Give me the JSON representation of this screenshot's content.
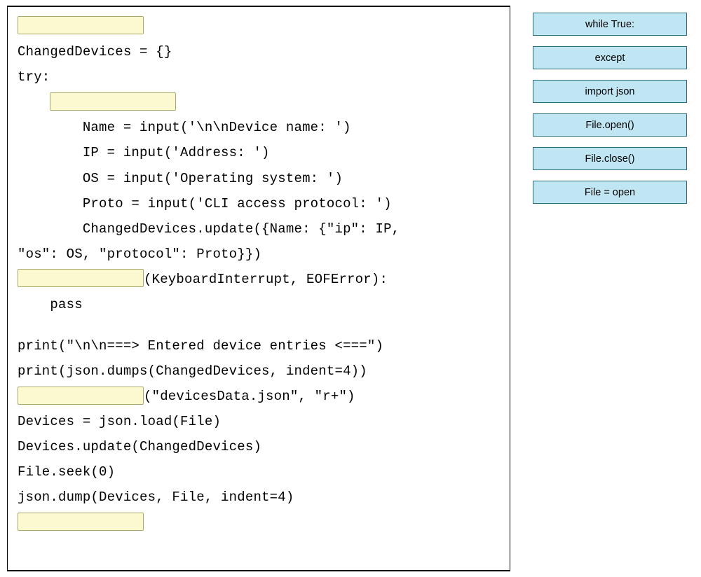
{
  "code": {
    "l1": "ChangedDevices = {}",
    "l2": "try:",
    "l3": "        Name = input('\\n\\nDevice name: ')",
    "l4": "        IP = input('Address: ')",
    "l5": "        OS = input('Operating system: ')",
    "l6": "        Proto = input('CLI access protocol: ')",
    "l7": "        ChangedDevices.update({Name: {\"ip\": IP,",
    "l8": "\"os\": OS, \"protocol\": Proto}})",
    "l9": "(KeyboardInterrupt, EOFError):",
    "l10": "    pass",
    "l11": "print(\"\\n\\n===> Entered device entries <===\")",
    "l12": "print(json.dumps(ChangedDevices, indent=4))",
    "l13": "(\"devicesData.json\", \"r+\")",
    "l14": "Devices = json.load(File)",
    "l15": "Devices.update(ChangedDevices)",
    "l16": "File.seek(0)",
    "l17": "json.dump(Devices, File, indent=4)"
  },
  "choices": {
    "c1": "while True:",
    "c2": "except",
    "c3": "import json",
    "c4": "File.open()",
    "c5": "File.close()",
    "c6": "File = open"
  }
}
